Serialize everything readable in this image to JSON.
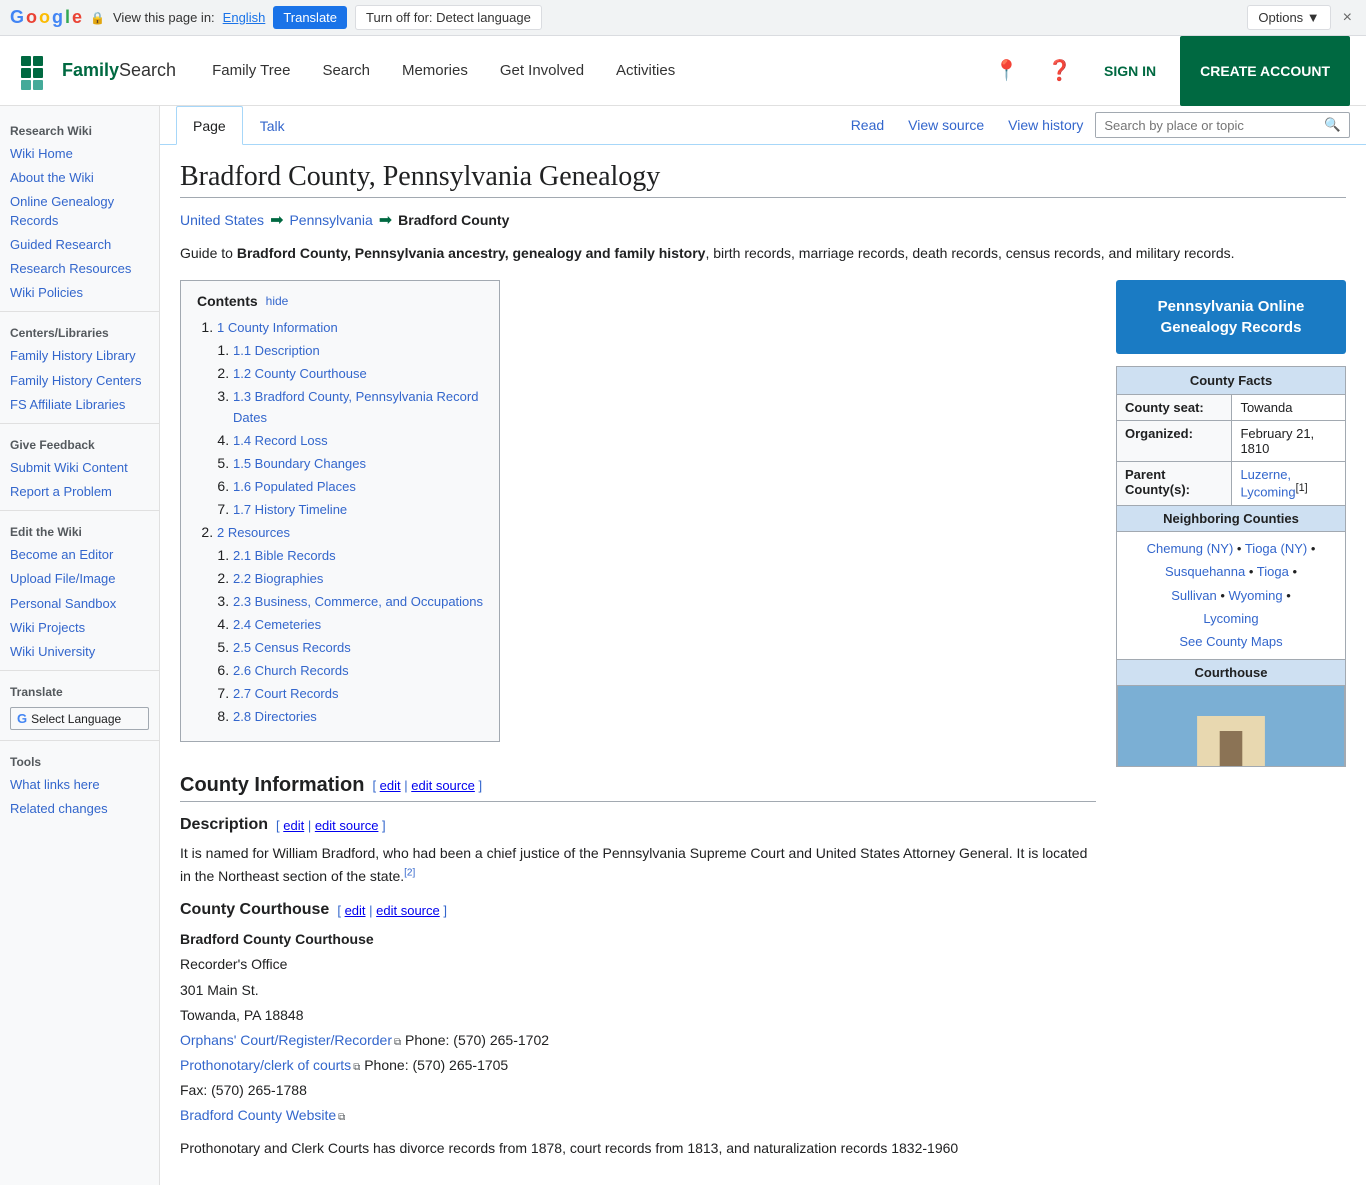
{
  "translate_bar": {
    "view_text": "View this page in:",
    "language": "English",
    "translate_btn": "Translate",
    "turnoff_btn": "Turn off for: Detect language",
    "options_btn": "Options ▼",
    "close_btn": "×"
  },
  "nav": {
    "logo_text": "FamilySearch",
    "links": [
      "Family Tree",
      "Search",
      "Memories",
      "Get Involved",
      "Activities"
    ],
    "sign_in": "SIGN IN",
    "create_account": "CREATE ACCOUNT"
  },
  "sidebar": {
    "research_wiki_title": "Research Wiki",
    "links1": [
      "Wiki Home",
      "About the Wiki",
      "Online Genealogy Records",
      "Guided Research",
      "Research Resources",
      "Wiki Policies"
    ],
    "centers_title": "Centers/Libraries",
    "links2": [
      "Family History Library",
      "Family History Centers",
      "FS Affiliate Libraries"
    ],
    "feedback_title": "Give Feedback",
    "links3": [
      "Submit Wiki Content",
      "Report a Problem"
    ],
    "edit_title": "Edit the Wiki",
    "links4": [
      "Become an Editor",
      "Upload File/Image",
      "Personal Sandbox",
      "Wiki Projects",
      "Wiki University"
    ],
    "translate_title": "Translate",
    "select_language": "Select Language",
    "tools_title": "Tools",
    "links5": [
      "What links here",
      "Related changes"
    ]
  },
  "wiki_tabs": {
    "page_tab": "Page",
    "talk_tab": "Talk",
    "read_tab": "Read",
    "view_source_tab": "View source",
    "view_history_tab": "View history",
    "search_placeholder": "Search by place or topic"
  },
  "article": {
    "title": "Bradford County, Pennsylvania Genealogy",
    "breadcrumb": {
      "us": "United States",
      "pa": "Pennsylvania",
      "county": "Bradford County"
    },
    "intro": "Guide to Bradford County, Pennsylvania ancestry, genealogy and family history, birth records, marriage records, death records, census records, and military records.",
    "toc_title": "Contents",
    "toc_hide": "hide",
    "toc_items": [
      {
        "num": "1",
        "label": "County Information"
      },
      {
        "num": "1.1",
        "label": "Description"
      },
      {
        "num": "1.2",
        "label": "County Courthouse"
      },
      {
        "num": "1.3",
        "label": "Bradford County, Pennsylvania Record Dates"
      },
      {
        "num": "1.4",
        "label": "Record Loss"
      },
      {
        "num": "1.5",
        "label": "Boundary Changes"
      },
      {
        "num": "1.6",
        "label": "Populated Places"
      },
      {
        "num": "1.7",
        "label": "History Timeline"
      },
      {
        "num": "2",
        "label": "Resources"
      },
      {
        "num": "2.1",
        "label": "Bible Records"
      },
      {
        "num": "2.2",
        "label": "Biographies"
      },
      {
        "num": "2.3",
        "label": "Business, Commerce, and Occupations"
      },
      {
        "num": "2.4",
        "label": "Cemeteries"
      },
      {
        "num": "2.5",
        "label": "Census Records"
      },
      {
        "num": "2.6",
        "label": "Church Records"
      },
      {
        "num": "2.7",
        "label": "Court Records"
      },
      {
        "num": "2.8",
        "label": "Directories"
      }
    ],
    "county_info_heading": "County Information",
    "edit_label": "edit",
    "edit_source_label": "edit source",
    "description_heading": "Description",
    "description_text": "It is named for William Bradford, who had been a chief justice of the Pennsylvania Supreme Court and United States Attorney General. It is located in the Northeast section of the state.",
    "desc_ref": "[2]",
    "courthouse_heading": "County Courthouse",
    "courthouse_name": "Bradford County Courthouse",
    "courthouse_office": "Recorder's Office",
    "courthouse_address": "301 Main St.",
    "courthouse_city": "Towanda, PA 18848",
    "orphans_court_label": "Orphans' Court/Register/Recorder",
    "orphans_phone": "Phone: (570) 265-1702",
    "prothonotary_label": "Prothonotary/clerk of courts",
    "prothonotary_phone": "Phone: (570) 265-1705",
    "fax": "Fax: (570) 265-1788",
    "website_label": "Bradford County Website",
    "prothonotary_text": "Prothonotary and Clerk Courts has divorce records from 1878, court records from 1813, and naturalization records 1832-1960"
  },
  "pa_button_label": "Pennsylvania Online Genealogy Records",
  "county_facts": {
    "title": "County Facts",
    "seat_label": "County seat:",
    "seat_value": "Towanda",
    "organized_label": "Organized:",
    "organized_value": "February 21, 1810",
    "parent_label": "Parent County(s):",
    "parent_value1": "Luzerne,",
    "parent_value2": "Lycoming",
    "parent_ref": "[1]",
    "neighboring_title": "Neighboring Counties",
    "neighbors": "Chemung (NY) • Tioga (NY) • Susquehanna • Tioga • Sullivan • Wyoming • Lycoming",
    "see_maps": "See County Maps",
    "courthouse_title": "Courthouse"
  }
}
